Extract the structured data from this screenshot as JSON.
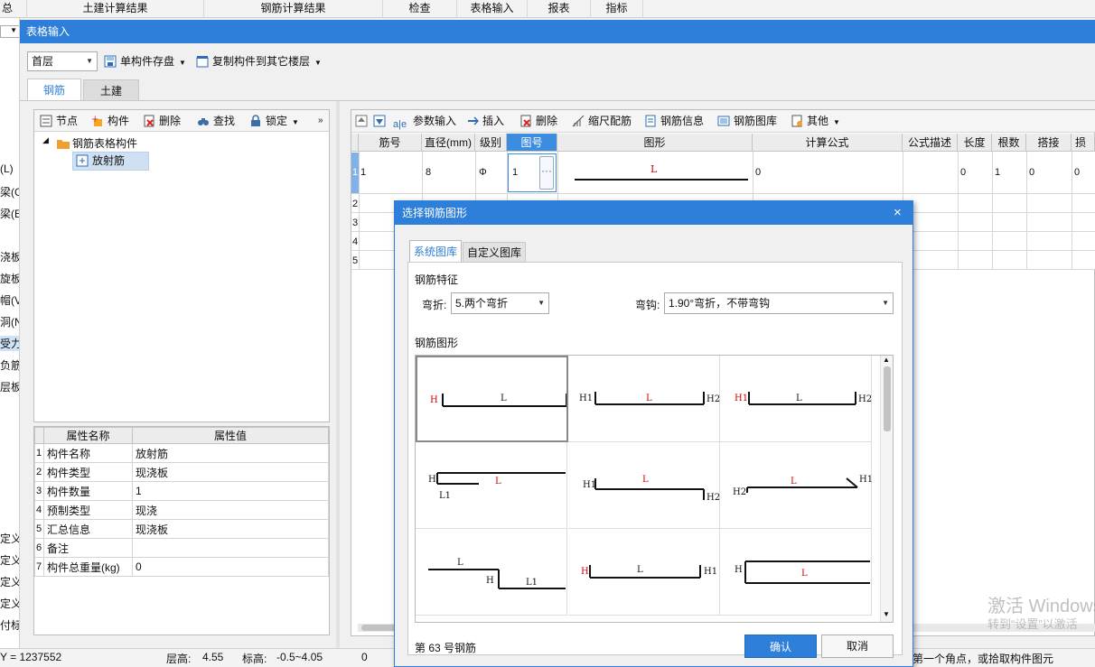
{
  "top_menu": [
    "总",
    "土建计算结果",
    "钢筋计算结果",
    "检查",
    "表格输入",
    "报表",
    "指标"
  ],
  "left_strip": [
    "(L)",
    "梁(G",
    "梁(E",
    "浇板",
    "旋板",
    "帽(V",
    "洞(N",
    "受力",
    "负筋",
    "层板",
    "定义",
    "定义",
    "定义",
    "定义",
    "付标"
  ],
  "window": {
    "title": "表格输入"
  },
  "toolbar": {
    "floor_value": "首层",
    "save_label": "单构件存盘",
    "copy_label": "复制构件到其它楼层"
  },
  "tabs": [
    "钢筋",
    "土建"
  ],
  "tree_toolbar": [
    "节点",
    "构件",
    "删除",
    "查找",
    "锁定"
  ],
  "tree": {
    "root": "钢筋表格构件",
    "child": "放射筋"
  },
  "properties": {
    "headers": [
      "属性名称",
      "属性值"
    ],
    "rows": [
      {
        "no": "1",
        "name": "构件名称",
        "value": "放射筋"
      },
      {
        "no": "2",
        "name": "构件类型",
        "value": "现浇板"
      },
      {
        "no": "3",
        "name": "构件数量",
        "value": "1"
      },
      {
        "no": "4",
        "name": "预制类型",
        "value": "现浇"
      },
      {
        "no": "5",
        "name": "汇总信息",
        "value": "现浇板"
      },
      {
        "no": "6",
        "name": "备注",
        "value": ""
      },
      {
        "no": "7",
        "name": "构件总重量(kg)",
        "value": "0"
      }
    ]
  },
  "grid_toolbar": [
    "参数输入",
    "插入",
    "删除",
    "缩尺配筋",
    "钢筋信息",
    "钢筋图库",
    "其他"
  ],
  "grid": {
    "headers": [
      "筋号",
      "直径(mm)",
      "级别",
      "图号",
      "图形",
      "计算公式",
      "公式描述",
      "长度",
      "根数",
      "搭接",
      "损耗"
    ],
    "row_numbers": [
      "1",
      "2",
      "3",
      "4",
      "5"
    ],
    "row1": {
      "bar_no": "1",
      "diameter": "8",
      "grade": "Φ",
      "shape_no": "1",
      "shape_label": "L",
      "formula": "0",
      "length": "0",
      "count": "1",
      "lap": "0",
      "loss": "0"
    }
  },
  "dialog": {
    "title": "选择钢筋图形",
    "tabs": [
      "系统图库",
      "自定义图库"
    ],
    "feature_label": "钢筋特征",
    "bend_label": "弯折:",
    "bend_value": "5.两个弯折",
    "hook_label": "弯钩:",
    "hook_value": "1.90°弯折，不带弯钩",
    "shapes_label": "钢筋图形",
    "current_shape": "第 63 号钢筋",
    "ok_label": "确认",
    "cancel_label": "取消",
    "shape_labels": {
      "s1": [
        "H",
        "L"
      ],
      "s2": [
        "H1",
        "L",
        "H2"
      ],
      "s3": [
        "H1",
        "L",
        "H2"
      ],
      "s4": [
        "H",
        "L",
        "L1"
      ],
      "s5": [
        "H1",
        "L",
        "H2"
      ],
      "s6": [
        "L",
        "H1",
        "H2"
      ],
      "s7": [
        "L",
        "H",
        "L1"
      ],
      "s8": [
        "H",
        "L",
        "H1"
      ],
      "s9": [
        "H",
        "L"
      ]
    }
  },
  "status": {
    "y_coord": "Y = 1237552",
    "floor_height_label": "层高:",
    "floor_height": "4.55",
    "elev_label": "标高:",
    "elev": "-0.5~4.05",
    "zero": "0",
    "hint": "第一个角点，或拾取构件图元"
  },
  "watermark": {
    "line1": "激活 Windows",
    "line2": "转到“设置”以激活"
  },
  "colors": {
    "accent": "#2e7fd9",
    "shape_red": "#cc0000"
  }
}
